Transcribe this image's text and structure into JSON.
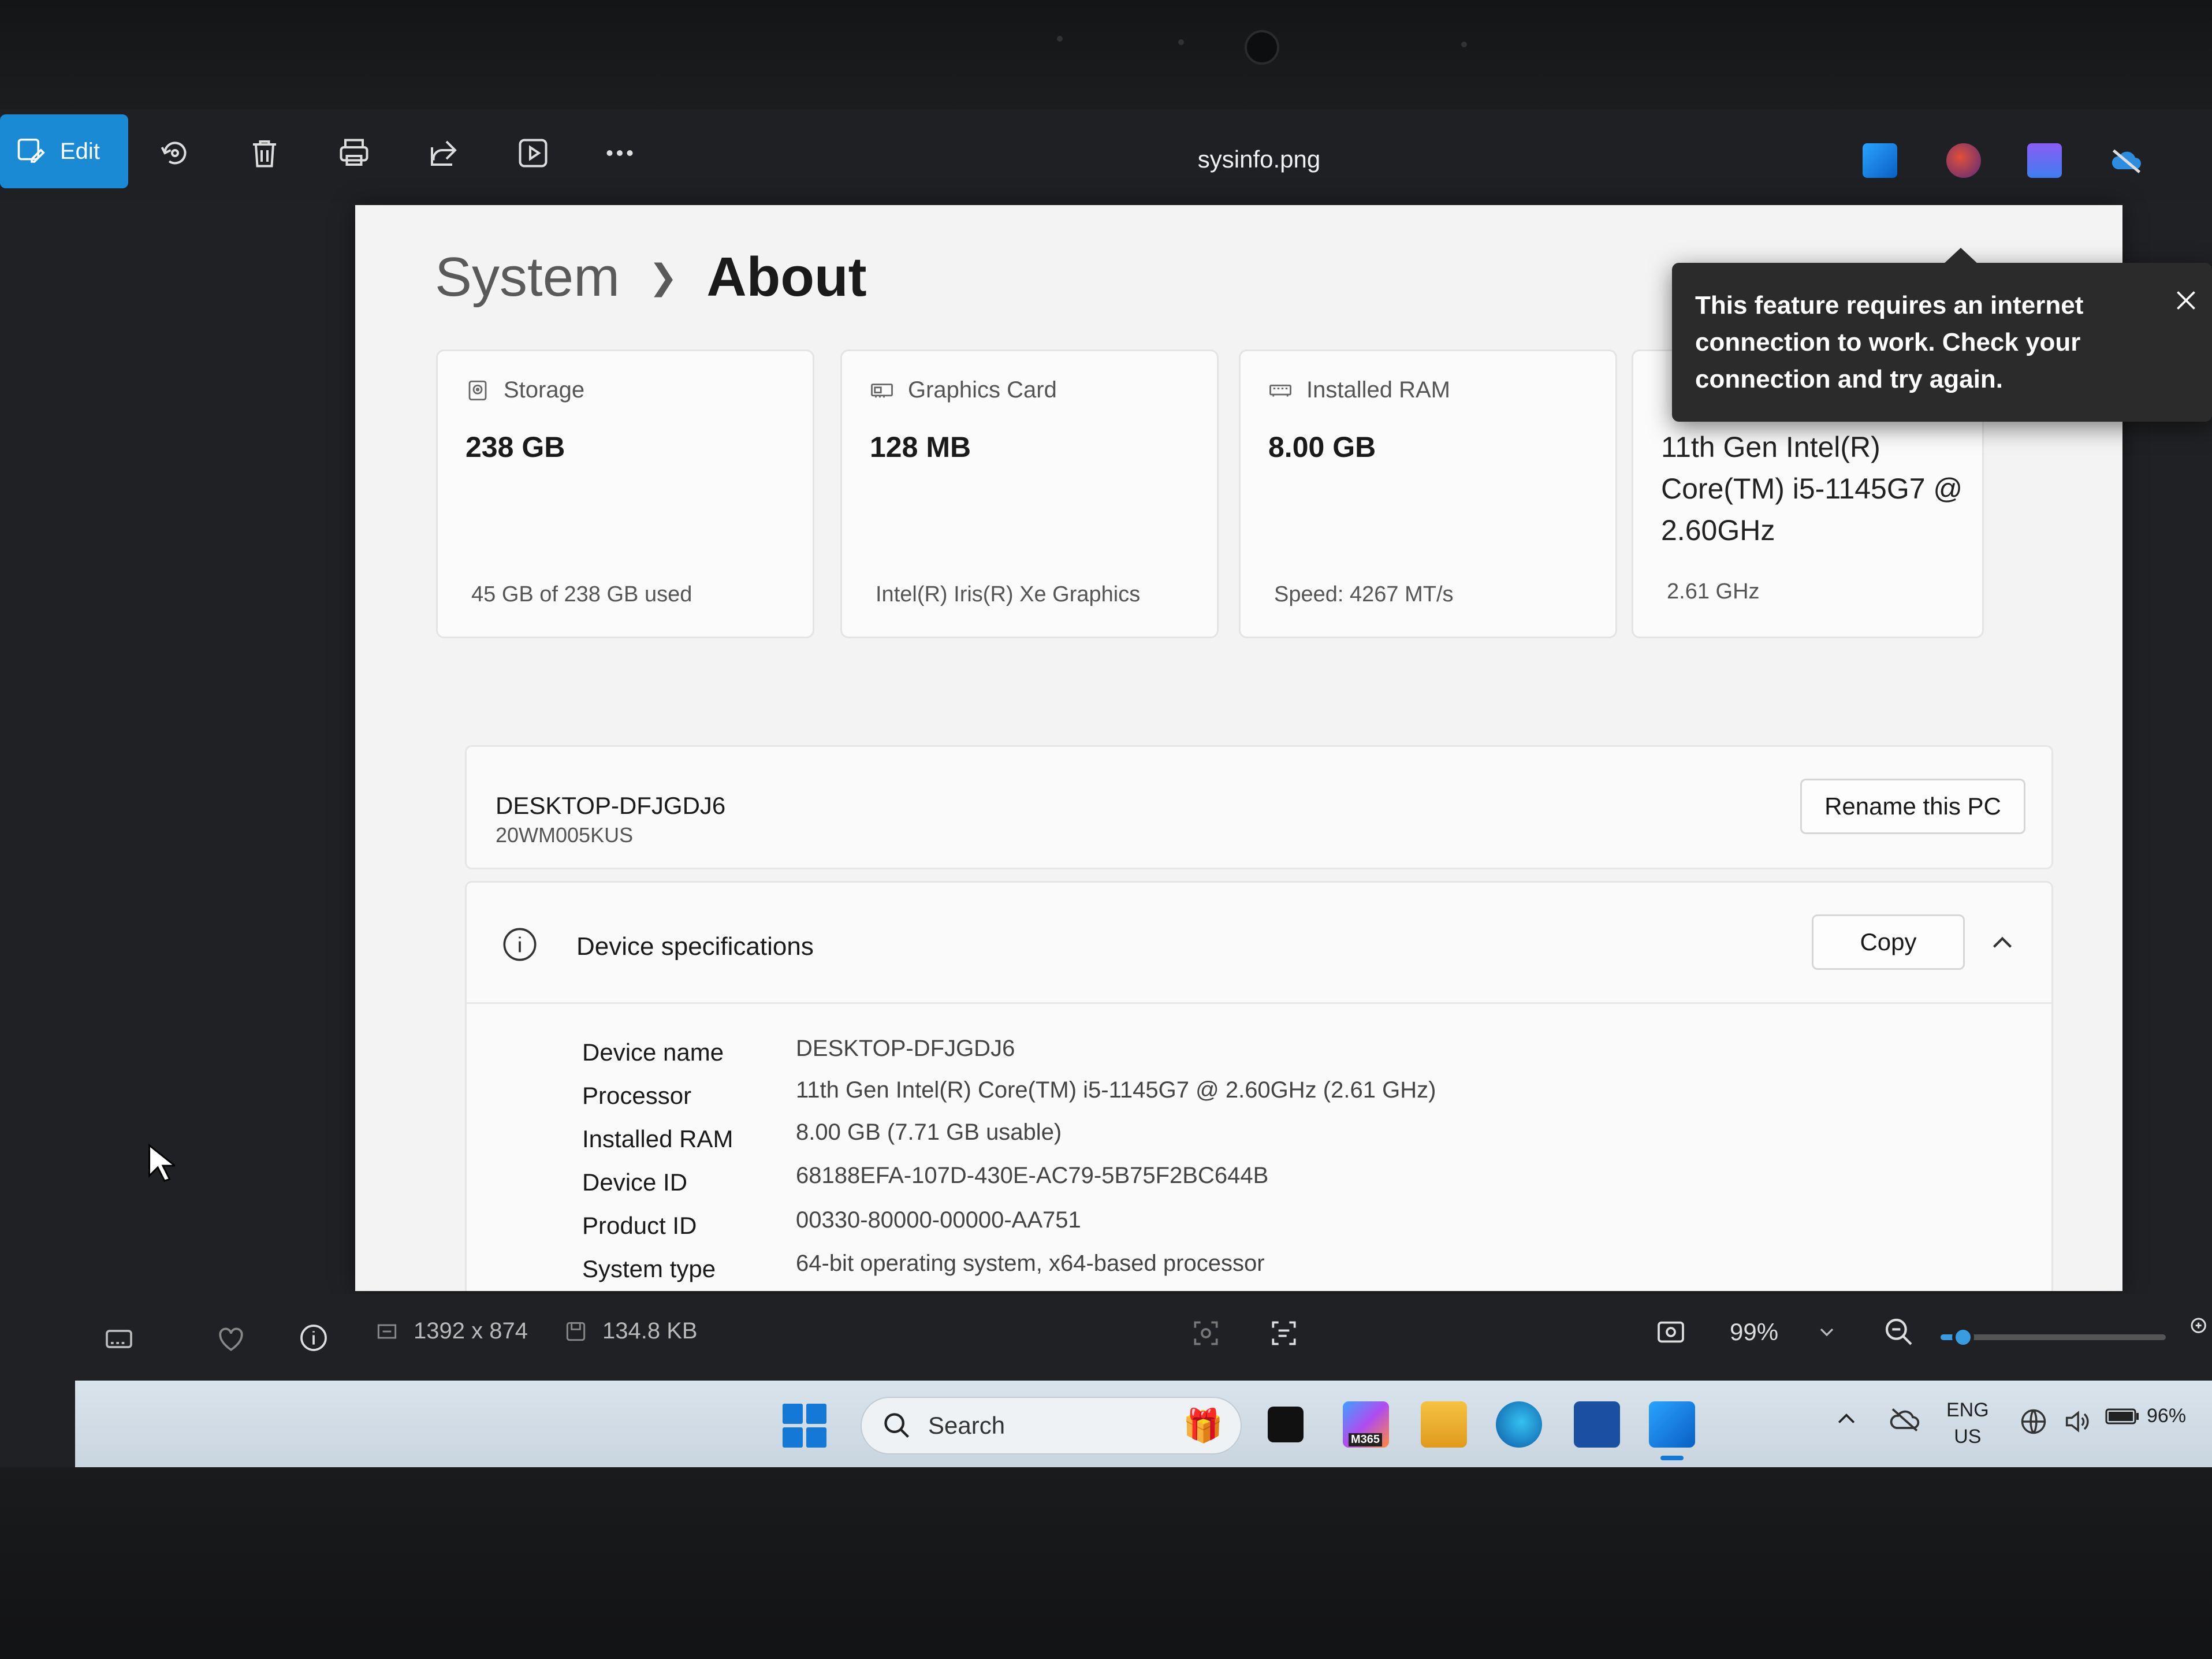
{
  "toolbar": {
    "edit_label": "Edit",
    "file_name": "sysinfo.png"
  },
  "page": {
    "breadcrumb_parent": "System",
    "breadcrumb_current": "About"
  },
  "cards": [
    {
      "label": "Storage",
      "value": "238 GB",
      "sub": "45 GB of 238 GB used"
    },
    {
      "label": "Graphics Card",
      "value": "128 MB",
      "sub": "Intel(R) Iris(R) Xe Graphics"
    },
    {
      "label": "Installed RAM",
      "value": "8.00 GB",
      "sub": "Speed: 4267 MT/s"
    },
    {
      "label": "",
      "value": "11th Gen Intel(R) Core(TM) i5-1145G7 @ 2.60GHz",
      "sub": "2.61 GHz"
    }
  ],
  "tooltip": {
    "text": "This feature requires an internet connection to work. Check your connection and try again."
  },
  "pc": {
    "name": "DESKTOP-DFJGDJ6",
    "model": "20WM005KUS",
    "rename_label": "Rename this PC"
  },
  "specs": {
    "title": "Device specifications",
    "copy_label": "Copy",
    "rows": [
      {
        "label": "Device name",
        "value": "DESKTOP-DFJGDJ6"
      },
      {
        "label": "Processor",
        "value": "11th Gen Intel(R) Core(TM) i5-1145G7 @ 2.60GHz (2.61 GHz)"
      },
      {
        "label": "Installed RAM",
        "value": "8.00 GB (7.71 GB usable)"
      },
      {
        "label": "Device ID",
        "value": "68188EFA-107D-430E-AC79-5B75F2BC644B"
      },
      {
        "label": "Product ID",
        "value": "00330-80000-00000-AA751"
      },
      {
        "label": "System type",
        "value": "64-bit operating system, x64-based processor"
      }
    ]
  },
  "statusbar": {
    "dimensions": "1392 x 874",
    "file_size": "134.8 KB",
    "zoom_label": "99%",
    "zoom_fraction": 0.1
  },
  "taskbar": {
    "search_placeholder": "Search",
    "m365_label": "M365",
    "lang_top": "ENG",
    "lang_bottom": "US",
    "battery": "96%"
  },
  "colors": {
    "accent": "#1a8ad4",
    "start_blue": "#1479d6"
  }
}
